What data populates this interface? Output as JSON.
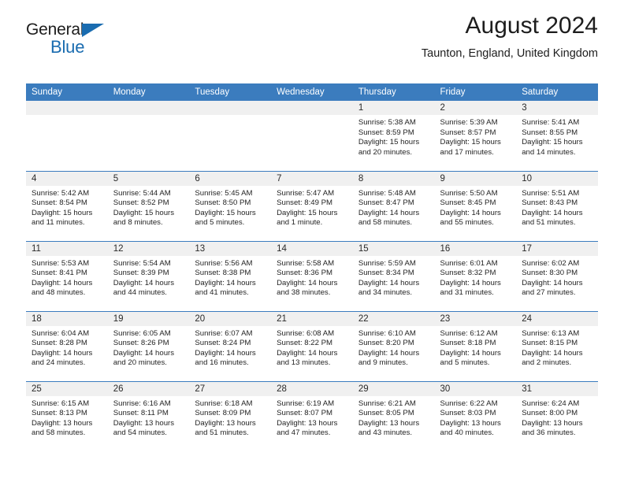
{
  "brand": {
    "name_dark": "General",
    "name_blue": "Blue",
    "accent_color": "#1a6cb0"
  },
  "header": {
    "title": "August 2024",
    "subtitle": "Taunton, England, United Kingdom",
    "header_bg_color": "#3b7cbe",
    "daynum_bg_color": "#f0f0f0"
  },
  "weekdays": [
    "Sunday",
    "Monday",
    "Tuesday",
    "Wednesday",
    "Thursday",
    "Friday",
    "Saturday"
  ],
  "labels": {
    "sunrise": "Sunrise:",
    "sunset": "Sunset:",
    "daylight": "Daylight:"
  },
  "weeks": [
    [
      {
        "day": "",
        "empty": true
      },
      {
        "day": "",
        "empty": true
      },
      {
        "day": "",
        "empty": true
      },
      {
        "day": "",
        "empty": true
      },
      {
        "day": "1",
        "sunrise": "Sunrise: 5:38 AM",
        "sunset": "Sunset: 8:59 PM",
        "daylight_1": "Daylight: 15 hours",
        "daylight_2": "and 20 minutes."
      },
      {
        "day": "2",
        "sunrise": "Sunrise: 5:39 AM",
        "sunset": "Sunset: 8:57 PM",
        "daylight_1": "Daylight: 15 hours",
        "daylight_2": "and 17 minutes."
      },
      {
        "day": "3",
        "sunrise": "Sunrise: 5:41 AM",
        "sunset": "Sunset: 8:55 PM",
        "daylight_1": "Daylight: 15 hours",
        "daylight_2": "and 14 minutes."
      }
    ],
    [
      {
        "day": "4",
        "sunrise": "Sunrise: 5:42 AM",
        "sunset": "Sunset: 8:54 PM",
        "daylight_1": "Daylight: 15 hours",
        "daylight_2": "and 11 minutes."
      },
      {
        "day": "5",
        "sunrise": "Sunrise: 5:44 AM",
        "sunset": "Sunset: 8:52 PM",
        "daylight_1": "Daylight: 15 hours",
        "daylight_2": "and 8 minutes."
      },
      {
        "day": "6",
        "sunrise": "Sunrise: 5:45 AM",
        "sunset": "Sunset: 8:50 PM",
        "daylight_1": "Daylight: 15 hours",
        "daylight_2": "and 5 minutes."
      },
      {
        "day": "7",
        "sunrise": "Sunrise: 5:47 AM",
        "sunset": "Sunset: 8:49 PM",
        "daylight_1": "Daylight: 15 hours",
        "daylight_2": "and 1 minute."
      },
      {
        "day": "8",
        "sunrise": "Sunrise: 5:48 AM",
        "sunset": "Sunset: 8:47 PM",
        "daylight_1": "Daylight: 14 hours",
        "daylight_2": "and 58 minutes."
      },
      {
        "day": "9",
        "sunrise": "Sunrise: 5:50 AM",
        "sunset": "Sunset: 8:45 PM",
        "daylight_1": "Daylight: 14 hours",
        "daylight_2": "and 55 minutes."
      },
      {
        "day": "10",
        "sunrise": "Sunrise: 5:51 AM",
        "sunset": "Sunset: 8:43 PM",
        "daylight_1": "Daylight: 14 hours",
        "daylight_2": "and 51 minutes."
      }
    ],
    [
      {
        "day": "11",
        "sunrise": "Sunrise: 5:53 AM",
        "sunset": "Sunset: 8:41 PM",
        "daylight_1": "Daylight: 14 hours",
        "daylight_2": "and 48 minutes."
      },
      {
        "day": "12",
        "sunrise": "Sunrise: 5:54 AM",
        "sunset": "Sunset: 8:39 PM",
        "daylight_1": "Daylight: 14 hours",
        "daylight_2": "and 44 minutes."
      },
      {
        "day": "13",
        "sunrise": "Sunrise: 5:56 AM",
        "sunset": "Sunset: 8:38 PM",
        "daylight_1": "Daylight: 14 hours",
        "daylight_2": "and 41 minutes."
      },
      {
        "day": "14",
        "sunrise": "Sunrise: 5:58 AM",
        "sunset": "Sunset: 8:36 PM",
        "daylight_1": "Daylight: 14 hours",
        "daylight_2": "and 38 minutes."
      },
      {
        "day": "15",
        "sunrise": "Sunrise: 5:59 AM",
        "sunset": "Sunset: 8:34 PM",
        "daylight_1": "Daylight: 14 hours",
        "daylight_2": "and 34 minutes."
      },
      {
        "day": "16",
        "sunrise": "Sunrise: 6:01 AM",
        "sunset": "Sunset: 8:32 PM",
        "daylight_1": "Daylight: 14 hours",
        "daylight_2": "and 31 minutes."
      },
      {
        "day": "17",
        "sunrise": "Sunrise: 6:02 AM",
        "sunset": "Sunset: 8:30 PM",
        "daylight_1": "Daylight: 14 hours",
        "daylight_2": "and 27 minutes."
      }
    ],
    [
      {
        "day": "18",
        "sunrise": "Sunrise: 6:04 AM",
        "sunset": "Sunset: 8:28 PM",
        "daylight_1": "Daylight: 14 hours",
        "daylight_2": "and 24 minutes."
      },
      {
        "day": "19",
        "sunrise": "Sunrise: 6:05 AM",
        "sunset": "Sunset: 8:26 PM",
        "daylight_1": "Daylight: 14 hours",
        "daylight_2": "and 20 minutes."
      },
      {
        "day": "20",
        "sunrise": "Sunrise: 6:07 AM",
        "sunset": "Sunset: 8:24 PM",
        "daylight_1": "Daylight: 14 hours",
        "daylight_2": "and 16 minutes."
      },
      {
        "day": "21",
        "sunrise": "Sunrise: 6:08 AM",
        "sunset": "Sunset: 8:22 PM",
        "daylight_1": "Daylight: 14 hours",
        "daylight_2": "and 13 minutes."
      },
      {
        "day": "22",
        "sunrise": "Sunrise: 6:10 AM",
        "sunset": "Sunset: 8:20 PM",
        "daylight_1": "Daylight: 14 hours",
        "daylight_2": "and 9 minutes."
      },
      {
        "day": "23",
        "sunrise": "Sunrise: 6:12 AM",
        "sunset": "Sunset: 8:18 PM",
        "daylight_1": "Daylight: 14 hours",
        "daylight_2": "and 5 minutes."
      },
      {
        "day": "24",
        "sunrise": "Sunrise: 6:13 AM",
        "sunset": "Sunset: 8:15 PM",
        "daylight_1": "Daylight: 14 hours",
        "daylight_2": "and 2 minutes."
      }
    ],
    [
      {
        "day": "25",
        "sunrise": "Sunrise: 6:15 AM",
        "sunset": "Sunset: 8:13 PM",
        "daylight_1": "Daylight: 13 hours",
        "daylight_2": "and 58 minutes."
      },
      {
        "day": "26",
        "sunrise": "Sunrise: 6:16 AM",
        "sunset": "Sunset: 8:11 PM",
        "daylight_1": "Daylight: 13 hours",
        "daylight_2": "and 54 minutes."
      },
      {
        "day": "27",
        "sunrise": "Sunrise: 6:18 AM",
        "sunset": "Sunset: 8:09 PM",
        "daylight_1": "Daylight: 13 hours",
        "daylight_2": "and 51 minutes."
      },
      {
        "day": "28",
        "sunrise": "Sunrise: 6:19 AM",
        "sunset": "Sunset: 8:07 PM",
        "daylight_1": "Daylight: 13 hours",
        "daylight_2": "and 47 minutes."
      },
      {
        "day": "29",
        "sunrise": "Sunrise: 6:21 AM",
        "sunset": "Sunset: 8:05 PM",
        "daylight_1": "Daylight: 13 hours",
        "daylight_2": "and 43 minutes."
      },
      {
        "day": "30",
        "sunrise": "Sunrise: 6:22 AM",
        "sunset": "Sunset: 8:03 PM",
        "daylight_1": "Daylight: 13 hours",
        "daylight_2": "and 40 minutes."
      },
      {
        "day": "31",
        "sunrise": "Sunrise: 6:24 AM",
        "sunset": "Sunset: 8:00 PM",
        "daylight_1": "Daylight: 13 hours",
        "daylight_2": "and 36 minutes."
      }
    ]
  ]
}
